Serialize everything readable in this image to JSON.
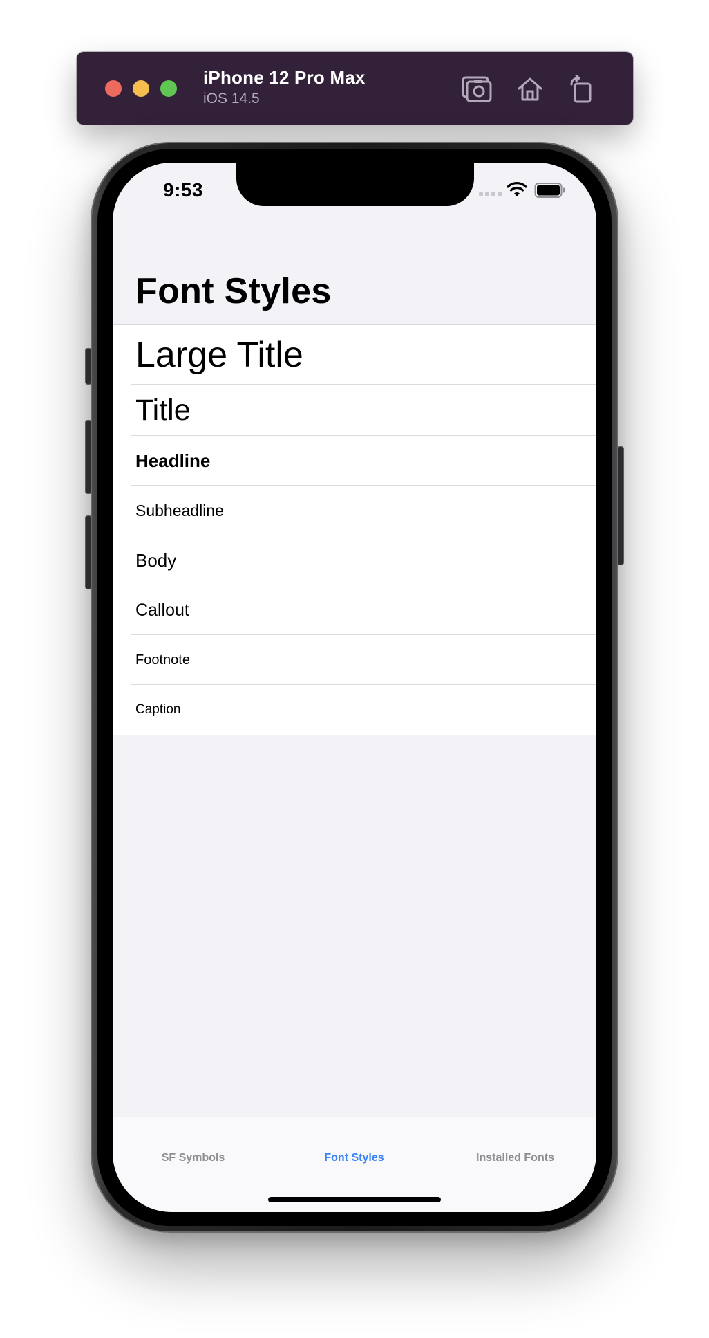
{
  "simulator": {
    "device_name": "iPhone 12 Pro Max",
    "os_version": "iOS 14.5",
    "toolbar_icons": [
      "screenshot-icon",
      "home-icon",
      "rotate-icon"
    ]
  },
  "status_bar": {
    "time": "9:53",
    "icons": [
      "cellular-signal-icon",
      "wifi-icon",
      "battery-icon"
    ]
  },
  "navigation": {
    "title": "Font Styles"
  },
  "font_styles": {
    "items": [
      {
        "label": "Large Title"
      },
      {
        "label": "Title"
      },
      {
        "label": "Headline"
      },
      {
        "label": "Subheadline"
      },
      {
        "label": "Body"
      },
      {
        "label": "Callout"
      },
      {
        "label": "Footnote"
      },
      {
        "label": "Caption"
      }
    ]
  },
  "tab_bar": {
    "tabs": [
      {
        "label": "SF Symbols",
        "selected": false
      },
      {
        "label": "Font Styles",
        "selected": true
      },
      {
        "label": "Installed Fonts",
        "selected": false
      }
    ],
    "selected_color": "#3a82f7",
    "unselected_color": "#8e8e93"
  },
  "colors": {
    "simulator_bar": "#33213a",
    "background": "#f2f2f7",
    "cell_background": "#ffffff"
  }
}
